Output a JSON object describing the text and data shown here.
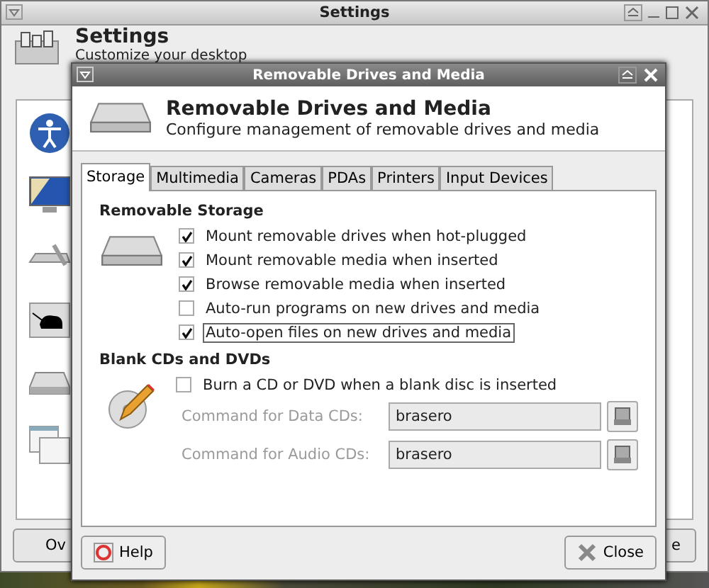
{
  "background_window": {
    "title": "Settings",
    "header": {
      "title": "Settings",
      "subtitle": "Customize your desktop"
    },
    "buttons": [
      "Ov",
      "e"
    ]
  },
  "dialog": {
    "title": "Removable Drives and Media",
    "header": {
      "title": "Removable Drives and Media",
      "subtitle": "Configure management of removable drives and media"
    },
    "tabs": [
      {
        "label": "Storage",
        "selected": true
      },
      {
        "label": "Multimedia",
        "selected": false
      },
      {
        "label": "Cameras",
        "selected": false
      },
      {
        "label": "PDAs",
        "selected": false
      },
      {
        "label": "Printers",
        "selected": false
      },
      {
        "label": "Input Devices",
        "selected": false
      }
    ],
    "sections": [
      {
        "title": "Removable Storage",
        "kind": "drive",
        "options": [
          {
            "label": "Mount removable drives when hot-plugged",
            "checked": true,
            "focused": false
          },
          {
            "label": "Mount removable media when inserted",
            "checked": true,
            "focused": false
          },
          {
            "label": "Browse removable media when inserted",
            "checked": true,
            "focused": false
          },
          {
            "label": "Auto-run programs on new drives and media",
            "checked": false,
            "focused": false
          },
          {
            "label": "Auto-open files on new drives and media",
            "checked": true,
            "focused": true
          }
        ]
      },
      {
        "title": "Blank CDs and DVDs",
        "kind": "disc",
        "options": [
          {
            "label": "Burn a CD or DVD when a blank disc is inserted",
            "checked": false,
            "focused": false
          }
        ],
        "commands": [
          {
            "label": "Command for Data CDs:",
            "value": "brasero",
            "disabled": true
          },
          {
            "label": "Command for Audio CDs:",
            "value": "brasero",
            "disabled": true
          }
        ]
      }
    ],
    "buttons": [
      {
        "label": "Help",
        "kind": "help"
      },
      {
        "label": "Close",
        "kind": "close"
      }
    ]
  }
}
